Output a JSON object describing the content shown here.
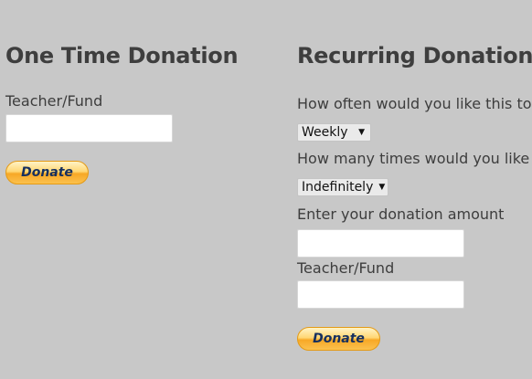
{
  "one_time": {
    "heading": "One Time Donation",
    "teacher_label": "Teacher/Fund",
    "teacher_value": "",
    "donate_label": "Donate"
  },
  "recurring": {
    "heading": "Recurring Donation",
    "frequency_label": "How often would you like this to",
    "frequency_selected": "Weekly",
    "times_label": "How many times would you like",
    "times_selected": "Indefinitely",
    "amount_label": "Enter your donation amount",
    "amount_value": "",
    "teacher_label": "Teacher/Fund",
    "teacher_value": "",
    "donate_label": "Donate"
  },
  "colors": {
    "background": "#c8c8c8",
    "text": "#3d3d3d",
    "button_border": "#e49a16",
    "button_text": "#16305f"
  },
  "icons": {
    "select_arrow": "dropdown-arrow-icon"
  }
}
